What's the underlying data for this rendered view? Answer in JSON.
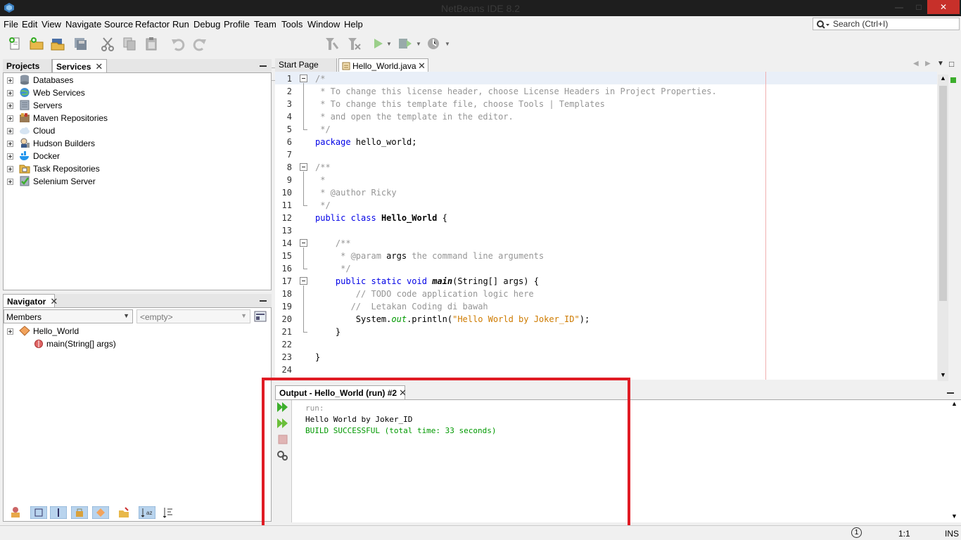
{
  "window": {
    "title": "NetBeans IDE 8.2"
  },
  "menu": [
    "File",
    "Edit",
    "View",
    "Navigate",
    "Source",
    "Refactor",
    "Run",
    "Debug",
    "Profile",
    "Team",
    "Tools",
    "Window",
    "Help"
  ],
  "search": {
    "placeholder": "Search (Ctrl+I)"
  },
  "left_tabs": {
    "projects": "Projects",
    "services": "Services"
  },
  "services": [
    "Databases",
    "Web Services",
    "Servers",
    "Maven Repositories",
    "Cloud",
    "Hudson Builders",
    "Docker",
    "Task Repositories",
    "Selenium Server"
  ],
  "navigator": {
    "title": "Navigator",
    "filter": "Members",
    "filter2": "<empty>",
    "class_name": "Hello_World",
    "method": "main(String[] args)"
  },
  "editor": {
    "tabs": [
      "Start Page",
      "Hello_World.java"
    ],
    "line_numbers": [
      "1",
      "2",
      "3",
      "4",
      "5",
      "6",
      "7",
      "8",
      "9",
      "10",
      "11",
      "12",
      "13",
      "14",
      "15",
      "16",
      "17",
      "18",
      "19",
      "20",
      "21",
      "22",
      "23",
      "24"
    ]
  },
  "output": {
    "title": "Output - Hello_World (run) #2",
    "run": "run:",
    "line1": "Hello World by Joker_ID",
    "line2": "BUILD SUCCESSFUL (total time: 33 seconds)"
  },
  "status": {
    "notifications": "1",
    "position": "1:1",
    "mode": "INS"
  },
  "colors": {
    "accent_red": "#e01b24",
    "keyword": "#0000e6",
    "comment": "#969696",
    "string": "#ce7b00",
    "build_success": "#009900"
  }
}
